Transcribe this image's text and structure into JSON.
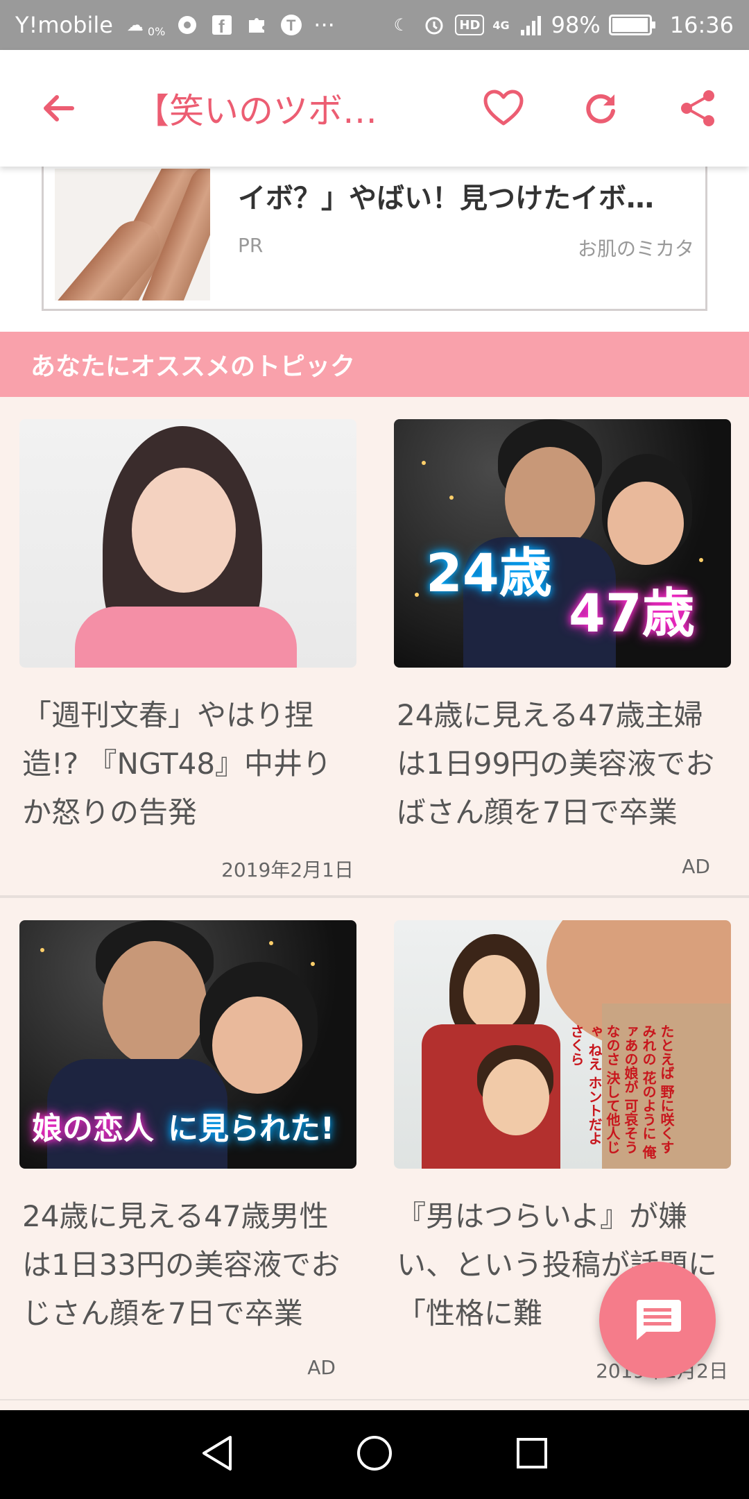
{
  "status_bar": {
    "carrier": "Y!mobile",
    "weather_pct": "0%",
    "icons_left": [
      "weather-icon",
      "chrome-icon",
      "facebook-icon",
      "puzzle-icon",
      "t-icon"
    ],
    "more": "···",
    "hd": "HD",
    "network": "4G",
    "battery": "98%",
    "time": "16:36"
  },
  "app_bar": {
    "title": "【笑いのツボ…"
  },
  "ad": {
    "title": "イボ？」やばい！見つけたイボ…",
    "label": "PR",
    "source": "お肌のミカタ"
  },
  "section": {
    "title": "あなたにオススメのトピック"
  },
  "cards": [
    {
      "title": "「週刊文春」やはり捏造!? 『NGT48』中井りか怒りの告発",
      "meta": "2019年2月1日"
    },
    {
      "title": "24歳に見える47歳主婦は1日99円の美容液でおばさん顔を7日で卒業",
      "meta": "AD",
      "overlay1": "24歳",
      "overlay2": "47歳"
    },
    {
      "title": "24歳に見える47歳男性は1日33円の美容液でおじさん顔を7日で卒業",
      "meta": "AD",
      "overlay1": "娘の恋人",
      "overlay2": "に見られた!"
    },
    {
      "title": "『男はつらいよ』が嫌い、という投稿が話題に　「性格に難",
      "meta": "2019年2月2日",
      "vertical_text": [
        "たとえば",
        "野に咲くすみれの",
        "花のように",
        "俺ァあの娘が",
        "可哀そうなのさ",
        "決して他人じゃ",
        "ねえ",
        "ホントだよ さくら"
      ]
    }
  ],
  "colors": {
    "accent": "#ec5d72",
    "section_bg": "#f9a1ab",
    "fab": "#f57c8a",
    "page_bg": "#fbf1ec"
  }
}
